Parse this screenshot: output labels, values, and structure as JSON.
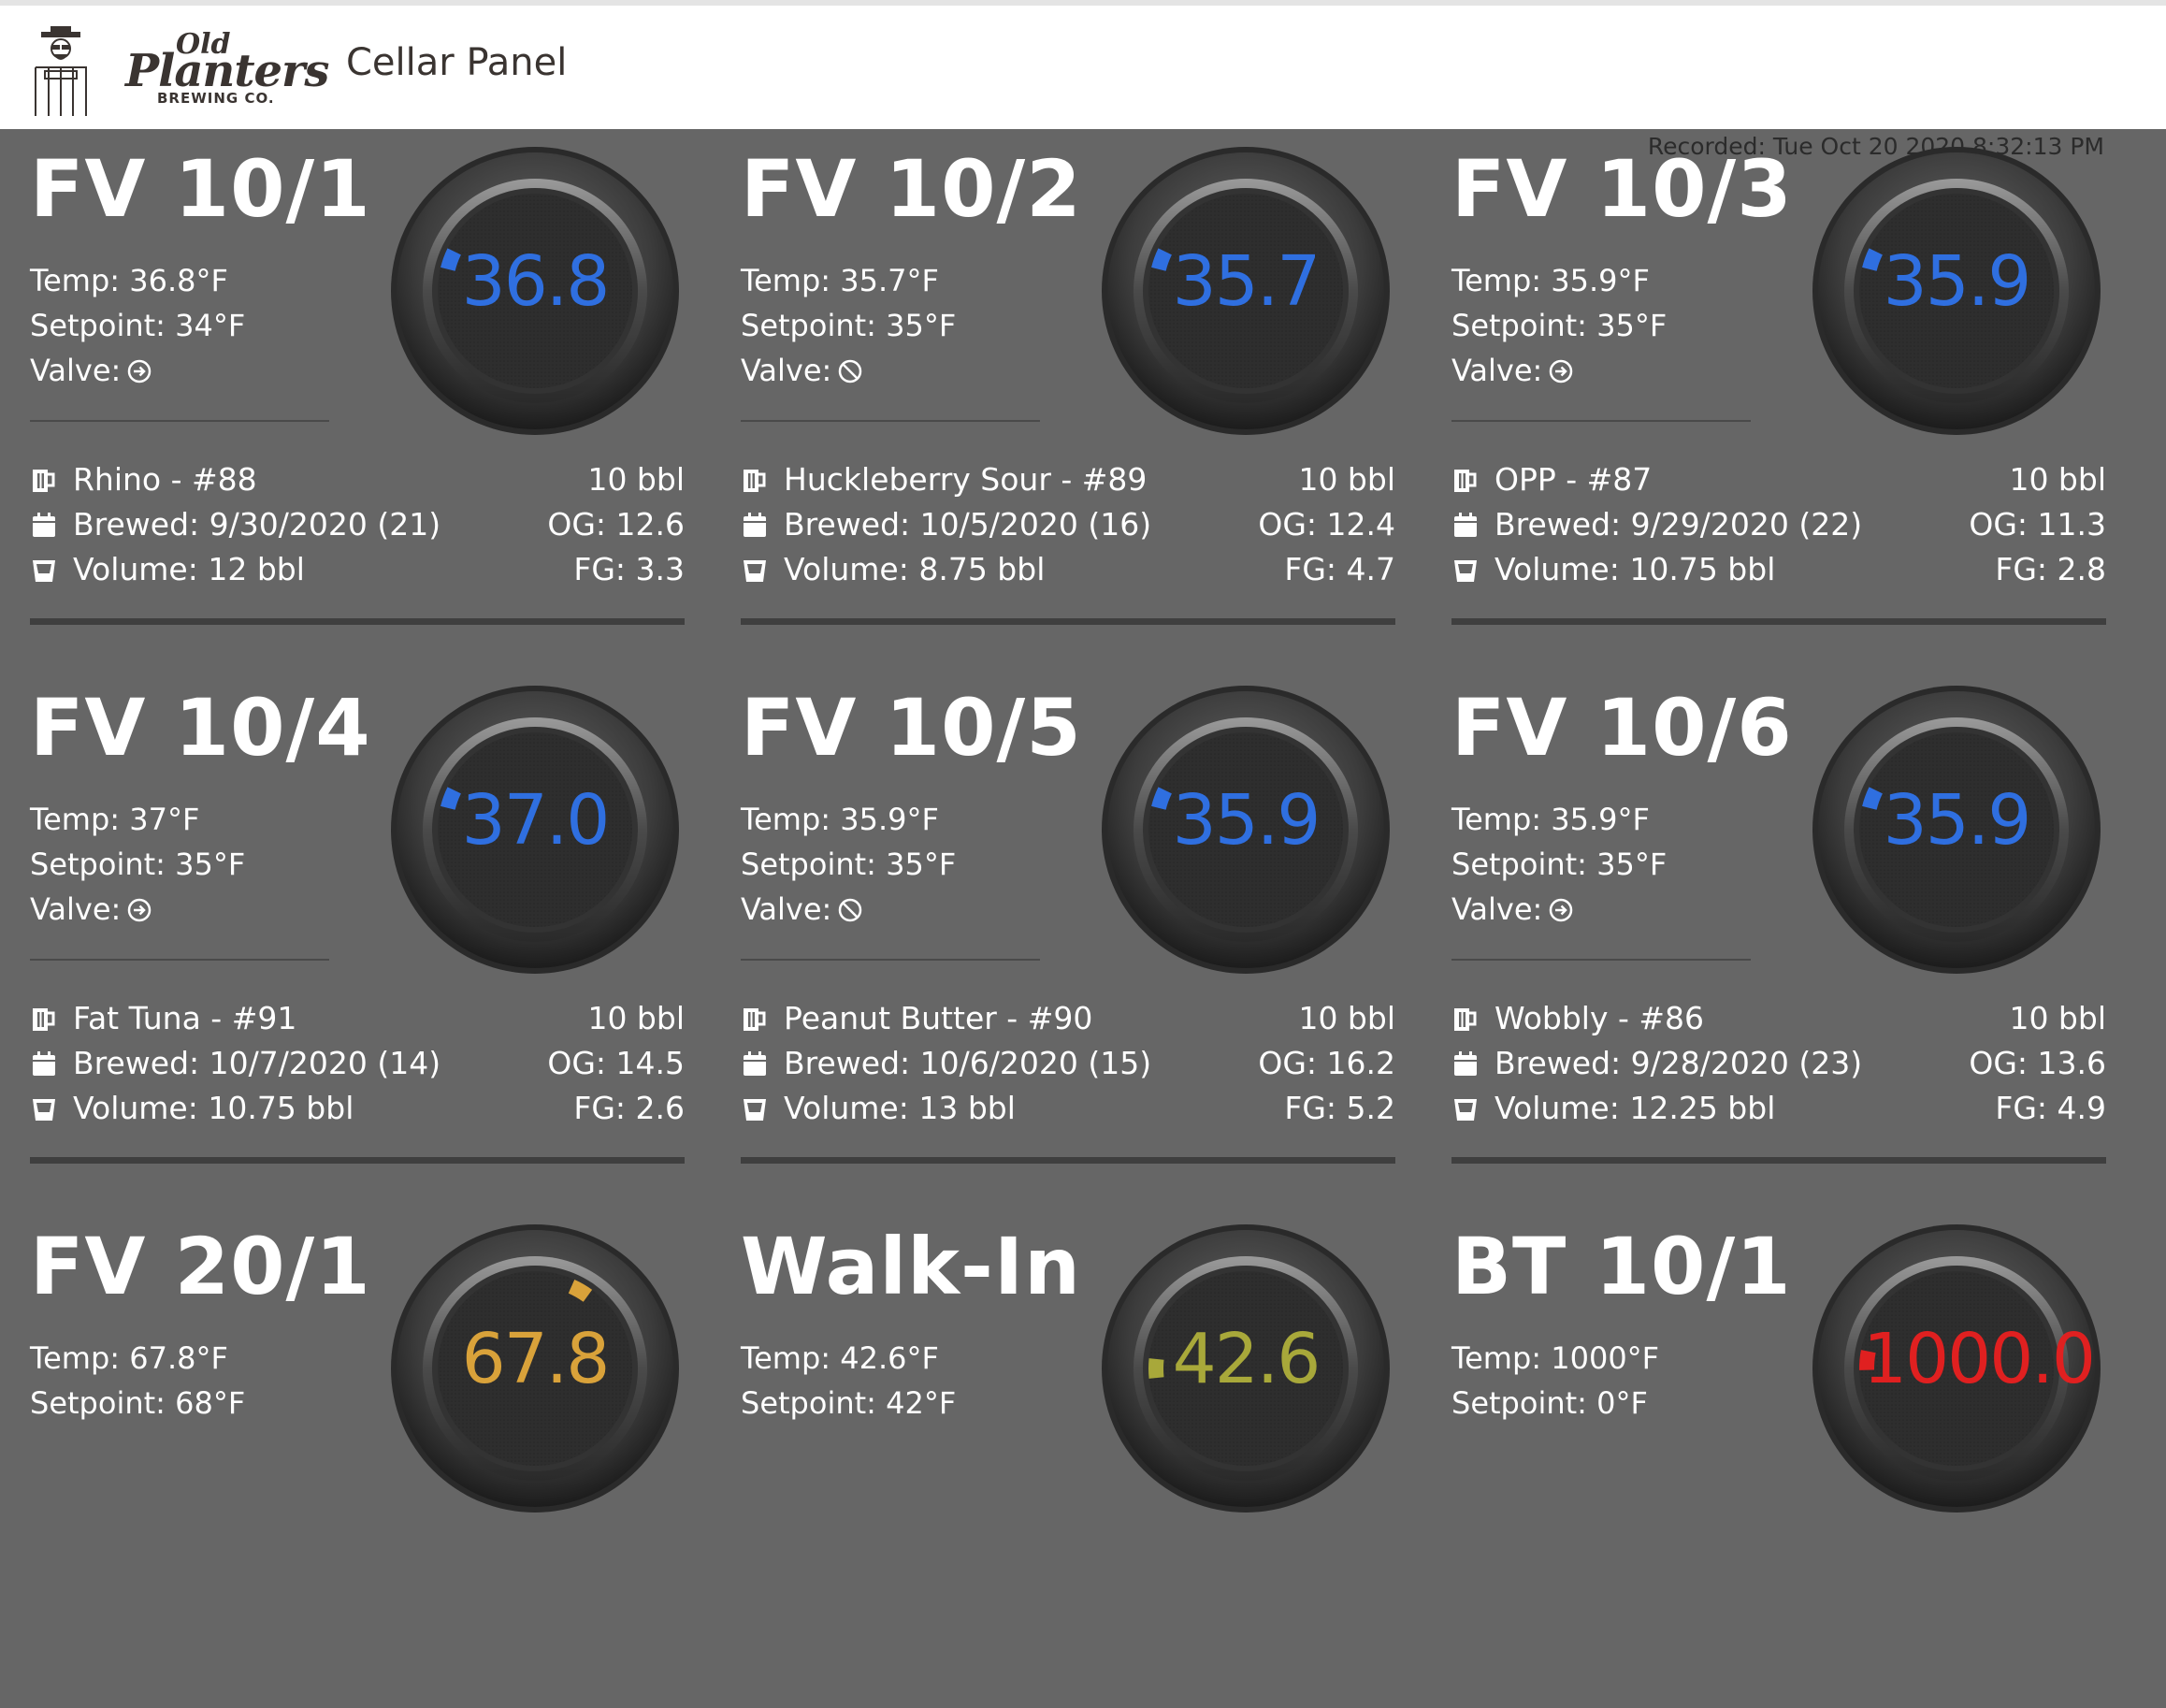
{
  "header": {
    "logo_old": "Old",
    "logo_planters": "Planters",
    "logo_brewing": "BREWING CO.",
    "title": "Cellar Panel"
  },
  "recorded": "Recorded: Tue Oct 20 2020 8:32:13 PM",
  "colors": {
    "background": "#666666",
    "header_bg": "#ffffff",
    "gauge_blue": "#2f6fe0",
    "gauge_orange": "#d9a23a",
    "gauge_olive": "#a8a83a",
    "gauge_red": "#e02020"
  },
  "fermenters": [
    {
      "name": "FV 10/1",
      "temp": "Temp: 36.8°F",
      "setpoint": "Setpoint: 34°F",
      "valve_label": "Valve:",
      "valve_icon": "arrow-circle-right-icon",
      "gauge_value": "36.8",
      "gauge_color": "#2f6fe0",
      "beer": "Rhino - #88",
      "size": "10 bbl",
      "brewed": "Brewed: 9/30/2020 (21)",
      "og": "OG: 12.6",
      "volume": "Volume: 12 bbl",
      "fg": "FG: 3.3"
    },
    {
      "name": "FV 10/2",
      "temp": "Temp: 35.7°F",
      "setpoint": "Setpoint: 35°F",
      "valve_label": "Valve:",
      "valve_icon": "ban-icon",
      "gauge_value": "35.7",
      "gauge_color": "#2f6fe0",
      "beer": "Huckleberry Sour - #89",
      "size": "10 bbl",
      "brewed": "Brewed: 10/5/2020 (16)",
      "og": "OG: 12.4",
      "volume": "Volume: 8.75 bbl",
      "fg": "FG: 4.7"
    },
    {
      "name": "FV 10/3",
      "temp": "Temp: 35.9°F",
      "setpoint": "Setpoint: 35°F",
      "valve_label": "Valve:",
      "valve_icon": "arrow-circle-right-icon",
      "gauge_value": "35.9",
      "gauge_color": "#2f6fe0",
      "beer": "OPP - #87",
      "size": "10 bbl",
      "brewed": "Brewed: 9/29/2020 (22)",
      "og": "OG: 11.3",
      "volume": "Volume: 10.75 bbl",
      "fg": "FG: 2.8"
    },
    {
      "name": "FV 10/4",
      "temp": "Temp: 37°F",
      "setpoint": "Setpoint: 35°F",
      "valve_label": "Valve:",
      "valve_icon": "arrow-circle-right-icon",
      "gauge_value": "37.0",
      "gauge_color": "#2f6fe0",
      "beer": "Fat Tuna - #91",
      "size": "10 bbl",
      "brewed": "Brewed: 10/7/2020 (14)",
      "og": "OG: 14.5",
      "volume": "Volume: 10.75 bbl",
      "fg": "FG: 2.6"
    },
    {
      "name": "FV 10/5",
      "temp": "Temp: 35.9°F",
      "setpoint": "Setpoint: 35°F",
      "valve_label": "Valve:",
      "valve_icon": "ban-icon",
      "gauge_value": "35.9",
      "gauge_color": "#2f6fe0",
      "beer": "Peanut Butter - #90",
      "size": "10 bbl",
      "brewed": "Brewed: 10/6/2020 (15)",
      "og": "OG: 16.2",
      "volume": "Volume: 13 bbl",
      "fg": "FG: 5.2"
    },
    {
      "name": "FV 10/6",
      "temp": "Temp: 35.9°F",
      "setpoint": "Setpoint: 35°F",
      "valve_label": "Valve:",
      "valve_icon": "arrow-circle-right-icon",
      "gauge_value": "35.9",
      "gauge_color": "#2f6fe0",
      "beer": "Wobbly - #86",
      "size": "10 bbl",
      "brewed": "Brewed: 9/28/2020 (23)",
      "og": "OG: 13.6",
      "volume": "Volume: 12.25 bbl",
      "fg": "FG: 4.9"
    },
    {
      "name": "FV 20/1",
      "temp": "Temp: 67.8°F",
      "setpoint": "Setpoint: 68°F",
      "gauge_value": "67.8",
      "gauge_color": "#d9a23a"
    },
    {
      "name": "Walk-In",
      "temp": "Temp: 42.6°F",
      "setpoint": "Setpoint: 42°F",
      "gauge_value": "42.6",
      "gauge_color": "#a8a83a"
    },
    {
      "name": "BT 10/1",
      "temp": "Temp: 1000°F",
      "setpoint": "Setpoint: 0°F",
      "gauge_value": "1000.0",
      "gauge_color": "#e02020"
    }
  ]
}
